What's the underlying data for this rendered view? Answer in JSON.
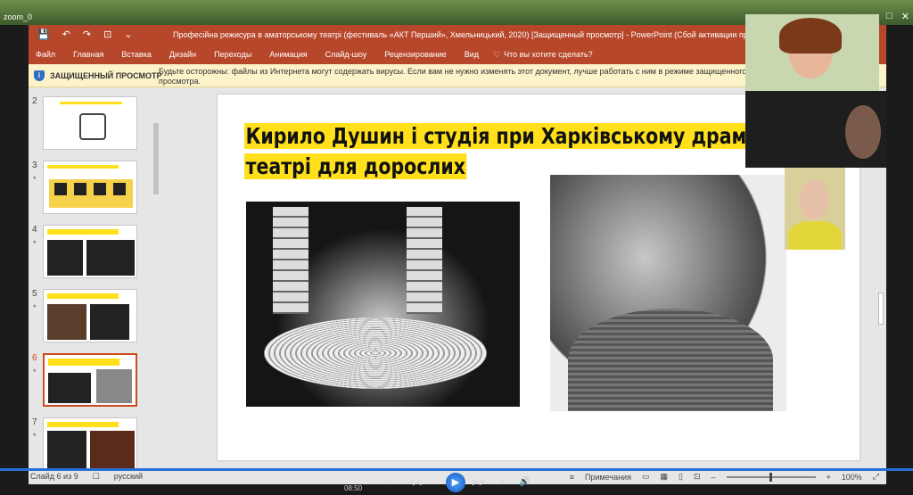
{
  "player": {
    "title": "zoom_0",
    "time": "08:50",
    "ctrl_prev": "⏮",
    "ctrl_rew": "◀◀",
    "ctrl_play": "▶",
    "ctrl_fwd": "▶▶",
    "ctrl_next": "⏭",
    "ctrl_vol": "🔊"
  },
  "window": {
    "title": "Професійна режисура в аматорському театрі (фестиваль «АКТ Перший», Хмельницький, 2020) [Защищенный просмотр] - PowerPoint (Сбой активации продукта)"
  },
  "ribbon": {
    "tabs": [
      "Файл",
      "Главная",
      "Вставка",
      "Дизайн",
      "Переходы",
      "Анимация",
      "Слайд-шоу",
      "Рецензирование",
      "Вид"
    ],
    "tell_me": "Что вы хотите сделать?"
  },
  "protected_view": {
    "label": "ЗАЩИЩЕННЫЙ ПРОСМОТР",
    "message": "Будьте осторожны: файлы из Интернета могут содержать вирусы. Если вам не нужно изменять этот документ, лучше работать с ним в режиме защищенного просмотра."
  },
  "thumbnails": [
    {
      "num": "2",
      "star": ""
    },
    {
      "num": "3",
      "star": "*"
    },
    {
      "num": "4",
      "star": "*"
    },
    {
      "num": "5",
      "star": "*"
    },
    {
      "num": "6",
      "star": "*"
    },
    {
      "num": "7",
      "star": "*"
    }
  ],
  "slide": {
    "title_line1": "Кирило Душин і студія при Харківському драматичному",
    "title_line2": "театрі для дорослих"
  },
  "status": {
    "slide_count": "Слайд 6 из 9",
    "language": "русский",
    "notes": "Примечания",
    "zoom": "100%"
  }
}
